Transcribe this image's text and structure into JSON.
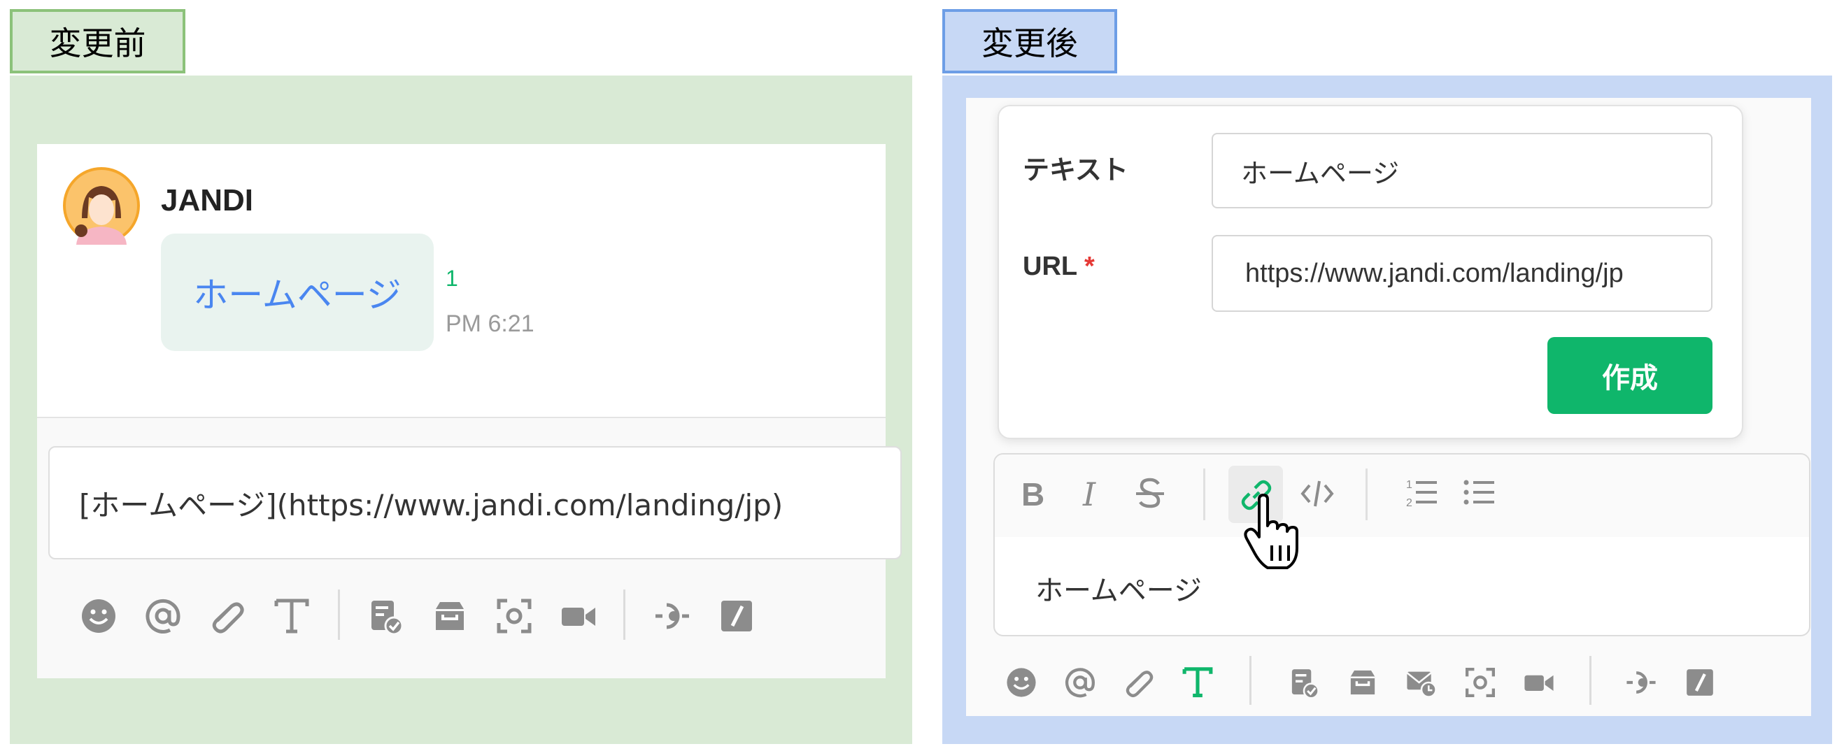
{
  "before": {
    "label": "変更前",
    "message": {
      "sender": "JANDI",
      "link_text": "ホームページ",
      "unread_count": "1",
      "time": "PM 6:21"
    },
    "input_value": "[ホームページ](https://www.jandi.com/landing/jp)",
    "toolbar_icons": [
      "emoji-icon",
      "mention-icon",
      "attach-icon",
      "text-format-icon",
      "todo-icon",
      "archive-icon",
      "screenshot-icon",
      "video-icon",
      "poll-icon",
      "slash-command-icon"
    ]
  },
  "after": {
    "label": "変更後",
    "link_dialog": {
      "text_label": "テキスト",
      "text_value": "ホームページ",
      "url_label": "URL",
      "required_mark": "*",
      "url_value": "https://www.jandi.com/landing/jp",
      "create_button": "作成"
    },
    "format_toolbar": [
      "bold-icon",
      "italic-icon",
      "strikethrough-icon",
      "link-icon",
      "code-icon",
      "ordered-list-icon",
      "bullet-list-icon"
    ],
    "editor_text": "ホームページ",
    "toolbar_icons": [
      "emoji-icon",
      "mention-icon",
      "attach-icon",
      "text-format-icon",
      "todo-icon",
      "archive-icon",
      "schedule-mail-icon",
      "screenshot-icon",
      "video-icon",
      "poll-icon",
      "slash-command-icon"
    ]
  },
  "colors": {
    "before_frame": "#8cc27a",
    "after_frame": "#6d9ee6",
    "accent_green": "#0fb66b",
    "link_blue": "#4a86f0",
    "required_red": "#e53935"
  }
}
